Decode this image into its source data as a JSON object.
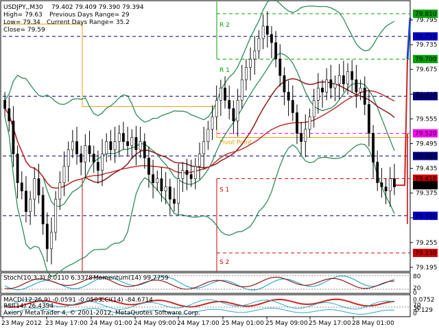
{
  "chart_data": {
    "type": "candlestick",
    "symbol_header": "USDJPY,,M30",
    "ohlc_text": "79.402 79.409 79.390 79.394",
    "info": {
      "high": "High= 79.63",
      "prev_range": "Previous Days Range= 29",
      "low": "Low= 79.34",
      "curr_range": "Current Days Range= 35.2",
      "close": "Close= 79.59"
    },
    "price_axis": {
      "min": 79.195,
      "max": 79.83,
      "ticks": [
        "79.795",
        "79.735",
        "79.675",
        "79.615",
        "79.555",
        "79.495",
        "79.435",
        "79.375",
        "79.315",
        "79.255",
        "79.195"
      ],
      "tick_values": [
        79.795,
        79.735,
        79.675,
        79.615,
        79.555,
        79.495,
        79.435,
        79.375,
        79.315,
        79.255,
        79.195
      ]
    },
    "price_labels": [
      {
        "text": "79.810",
        "value": 79.81,
        "color": "#00a000"
      },
      {
        "text": "79.755",
        "value": 79.755,
        "color": "#0000cc"
      },
      {
        "text": "79.700",
        "value": 79.7,
        "color": "#00a000"
      },
      {
        "text": "79.610",
        "value": 79.61,
        "color": "#000080"
      },
      {
        "text": "79.520",
        "value": 79.52,
        "color": "#ff00ff"
      },
      {
        "text": "79.465",
        "value": 79.465,
        "color": "#000080"
      },
      {
        "text": "79.410",
        "value": 79.41,
        "color": "#cc0000"
      },
      {
        "text": "79.394",
        "value": 79.394,
        "color": "#000000"
      },
      {
        "text": "79.320",
        "value": 79.32,
        "color": "#0000cc"
      },
      {
        "text": "79.230",
        "value": 79.23,
        "color": "#cc0000"
      }
    ],
    "pivot_labels": [
      {
        "text": "R 2",
        "value": 79.795
      },
      {
        "text": "R 1",
        "value": 79.685
      },
      {
        "text": "Pivot Point",
        "value": 79.51
      },
      {
        "text": "S 1",
        "value": 79.395
      },
      {
        "text": "S 2",
        "value": 79.22
      }
    ],
    "x_labels": [
      "23 May 2012",
      "23 May 17:00",
      "24 May 01:00",
      "24 May 09:00",
      "24 May 17:00",
      "25 May 01:00",
      "25 May 09:00",
      "25 May 17:00",
      "28 May 01:00"
    ],
    "closes": [
      79.58,
      79.55,
      79.47,
      79.4,
      79.38,
      79.33,
      79.36,
      79.41,
      79.37,
      79.3,
      79.24,
      79.28,
      79.36,
      79.4,
      79.44,
      79.48,
      79.5,
      79.47,
      79.45,
      79.49,
      79.47,
      79.45,
      79.43,
      79.47,
      79.5,
      79.48,
      79.5,
      79.52,
      79.5,
      79.49,
      79.51,
      79.48,
      79.5,
      79.46,
      79.42,
      79.4,
      79.41,
      79.38,
      79.39,
      79.36,
      79.35,
      79.41,
      79.43,
      79.42,
      79.41,
      79.44,
      79.47,
      79.5,
      79.53,
      79.56,
      79.6,
      79.63,
      79.6,
      79.58,
      79.55,
      79.6,
      79.65,
      79.68,
      79.7,
      79.72,
      79.75,
      79.78,
      79.76,
      79.74,
      79.7,
      79.66,
      79.62,
      79.6,
      79.57,
      79.52,
      79.5,
      79.53,
      79.56,
      79.6,
      79.63,
      79.62,
      79.65,
      79.63,
      79.64,
      79.66,
      79.64,
      79.67,
      79.65,
      79.62,
      79.63,
      79.59,
      79.52,
      79.45,
      79.4,
      79.39,
      79.38,
      79.41,
      79.39
    ],
    "stoch": {
      "label": "Stoch(10,3,3) 8.0110 6.3378",
      "momentum": "Momentum(14) 99.7759",
      "levels": [
        "80",
        "20",
        "0"
      ]
    },
    "macd": {
      "label": "MACD(12,26,9) -0.0591 -0.0503",
      "cci": "CCI(14) -84.6714",
      "levels": [
        "0.0752",
        "-0.129"
      ]
    },
    "rsi": {
      "label": "RSI(14) 26.4394",
      "levels": [
        "70",
        "30",
        "0"
      ]
    },
    "footer": "Axiory MetaTrader 4, © 2001-2012, MetaQuotes Software Corp."
  }
}
